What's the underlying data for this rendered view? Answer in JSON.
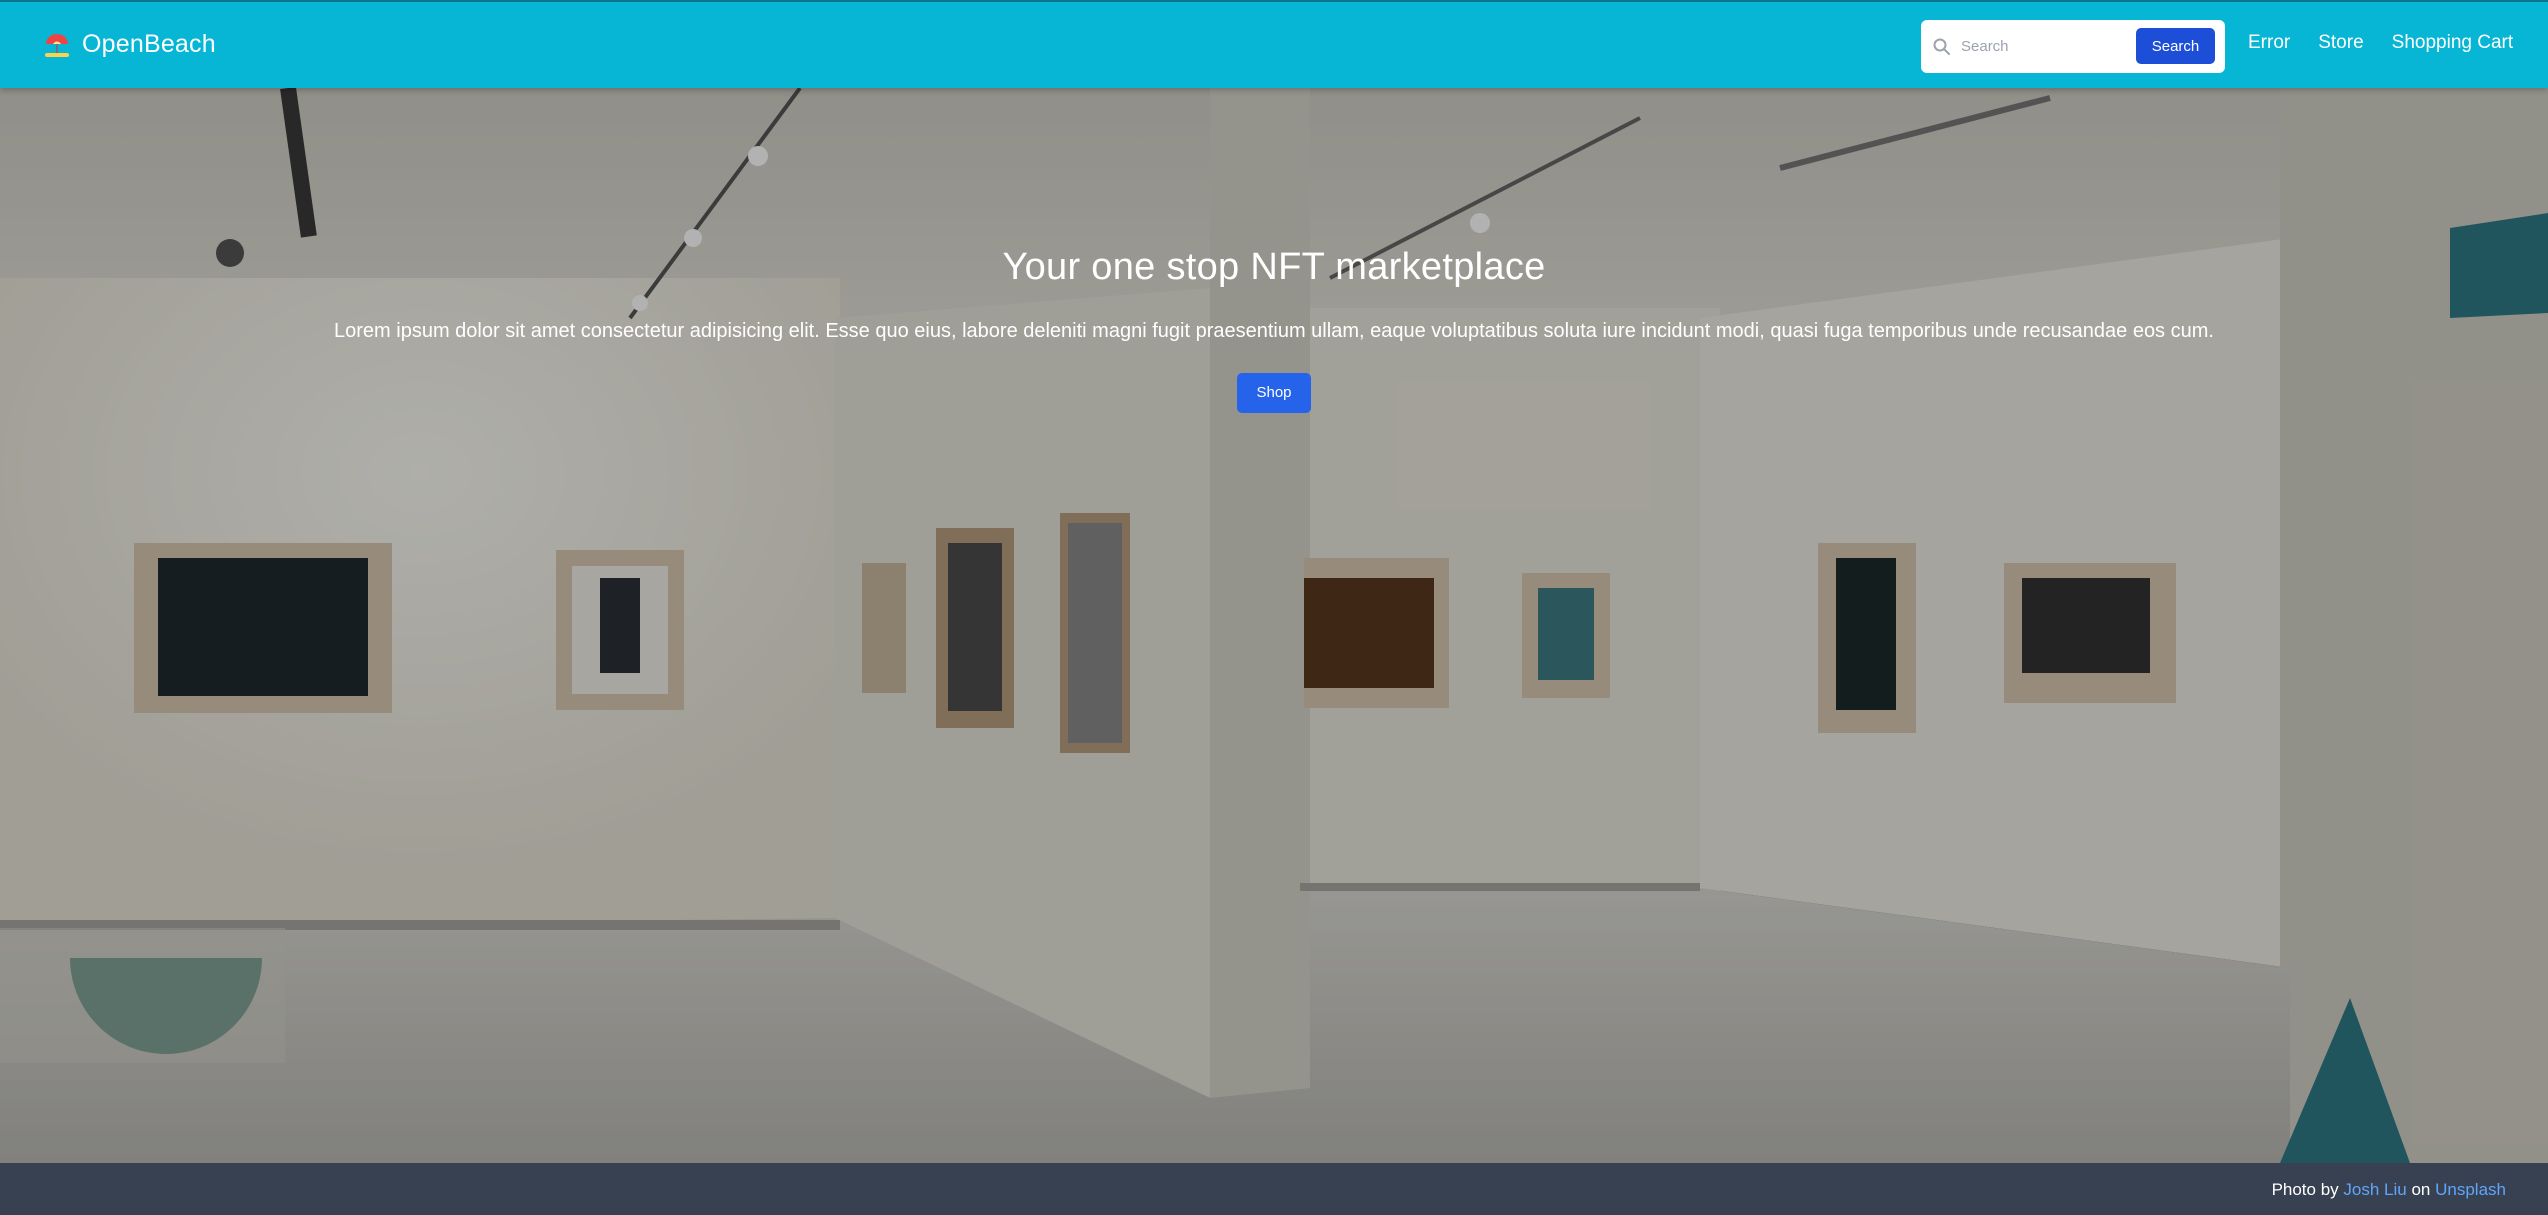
{
  "navbar": {
    "brand": "OpenBeach",
    "brand_icon": "beach-umbrella-icon",
    "search": {
      "placeholder": "Search",
      "button_label": "Search"
    },
    "links": [
      "Error",
      "Store",
      "Shopping Cart"
    ]
  },
  "hero": {
    "title": "Your one stop NFT marketplace",
    "text": "Lorem ipsum dolor sit amet consectetur adipisicing elit. Esse quo eius, labore deleniti magni fugit praesentium ullam, eaque voluptatibus soluta iure incidunt modi, quasi fuga temporibus unde recusandae eos cum.",
    "button_label": "Shop",
    "background": "art-gallery-photo"
  },
  "footer": {
    "prefix": "Photo by",
    "author": "Josh Liu",
    "middle": "on",
    "source": "Unsplash"
  },
  "colors": {
    "navbar": "#06b6d4",
    "primary_button": "#2563eb",
    "search_button": "#1d4ed8",
    "footer": "#374151",
    "link": "#60a5fa"
  }
}
